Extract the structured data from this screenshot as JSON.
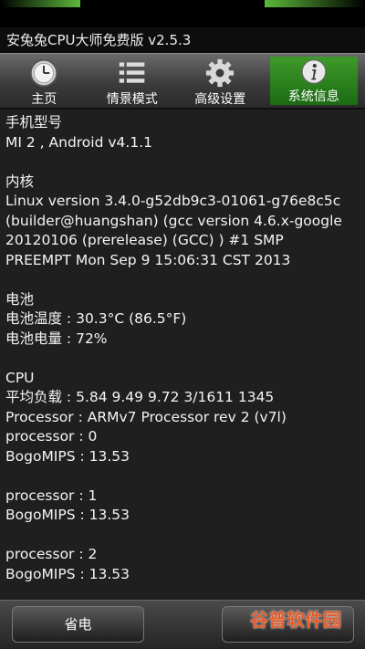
{
  "app": {
    "title": "安兔兔CPU大师免费版 v2.5.3"
  },
  "tabs": [
    {
      "label": "主页",
      "icon": "clock-icon",
      "active": false
    },
    {
      "label": "情景模式",
      "icon": "list-icon",
      "active": false
    },
    {
      "label": "高级设置",
      "icon": "gear-icon",
      "active": false
    },
    {
      "label": "系统信息",
      "icon": "info-icon",
      "active": true
    }
  ],
  "sections": {
    "model": {
      "heading": "手机型号",
      "lines": [
        "MI 2 , Android v4.1.1"
      ]
    },
    "kernel": {
      "heading": "内核",
      "lines": [
        "Linux version 3.4.0-g52db9c3-01061-g76e8c5c",
        "(builder@huangshan) (gcc version 4.6.x-google",
        "20120106 (prerelease) (GCC) ) #1 SMP",
        "PREEMPT Mon Sep 9 15:06:31 CST 2013"
      ]
    },
    "battery": {
      "heading": "电池",
      "lines": [
        "电池温度 : 30.3°C (86.5°F)",
        "电池电量 : 72%"
      ]
    },
    "cpu": {
      "heading": "CPU",
      "lines": [
        "平均负载 : 5.84 9.49 9.72 3/1611 1345",
        "Processor : ARMv7 Processor rev 2 (v7l)",
        "processor : 0",
        "BogoMIPS : 13.53"
      ]
    },
    "cpu1": {
      "lines": [
        "processor : 1",
        "BogoMIPS : 13.53"
      ]
    },
    "cpu2": {
      "lines": [
        "processor : 2",
        "BogoMIPS : 13.53"
      ]
    }
  },
  "bottom": {
    "left_button": "省电",
    "right_button": ""
  },
  "watermark": "谷普软件园",
  "colors": {
    "accent": "#2e8b1f",
    "watermark": "#e65b2a"
  }
}
